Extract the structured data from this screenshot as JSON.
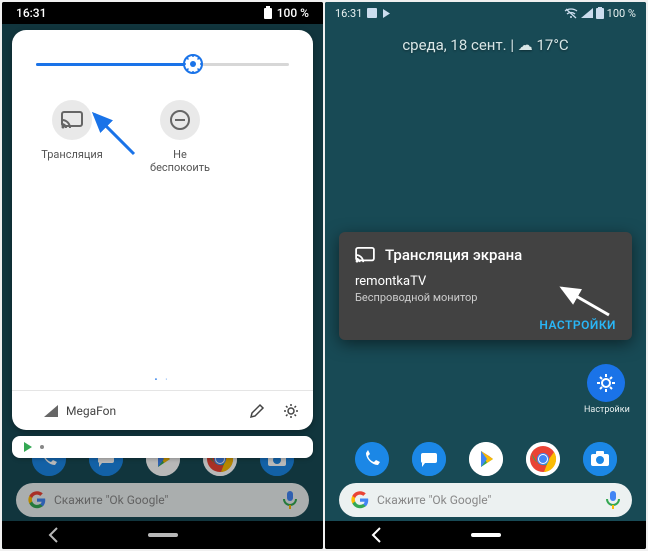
{
  "left": {
    "status": {
      "time": "16:31",
      "battery": "100 %"
    },
    "tiles": [
      {
        "name": "cast",
        "label": "Трансляция"
      },
      {
        "name": "dnd",
        "label": "Не беспокоить"
      }
    ],
    "footer": {
      "carrier": "MegaFon"
    },
    "search_placeholder": "Скажите \"Ok Google\""
  },
  "right": {
    "status": {
      "time": "16:31",
      "battery": "100 %"
    },
    "dateline": "среда, 18 сент.  |  ☁ 17°C",
    "card": {
      "title": "Трансляция экрана",
      "device": "remontkaTV",
      "subtitle": "Беспроводной монитор",
      "action": "НАСТРОЙКИ"
    },
    "home_settings_label": "Настройки",
    "search_placeholder": "Скажите \"Ok Google\""
  }
}
